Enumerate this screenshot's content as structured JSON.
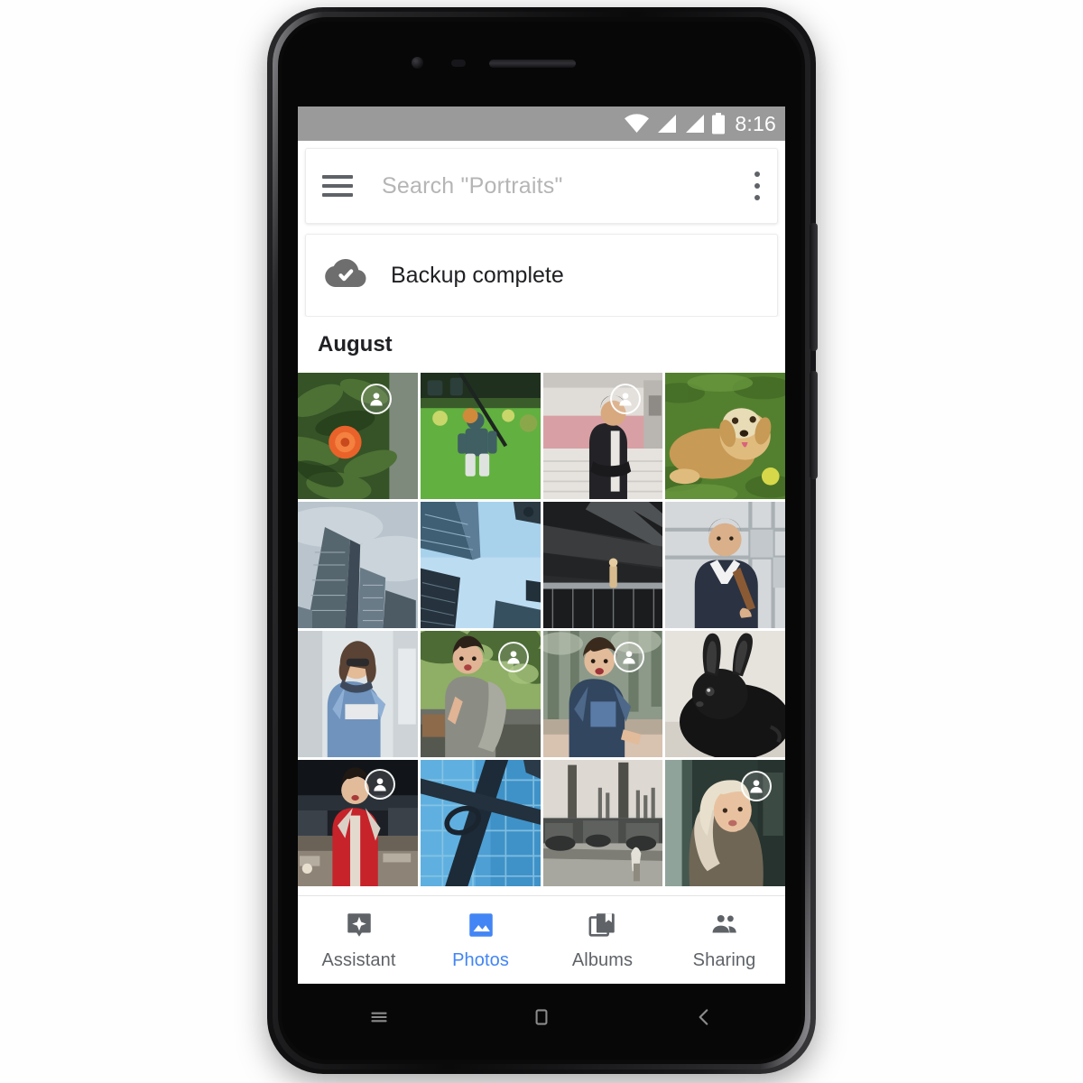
{
  "device": {
    "name": "android-smartphone",
    "hardware_buttons": [
      "volume-rocker",
      "power-button"
    ]
  },
  "statusbar": {
    "time": "8:16",
    "icons": [
      "wifi-icon",
      "signal-icon",
      "signal-icon",
      "battery-icon"
    ],
    "background": "#9a9a9a"
  },
  "searchbar": {
    "menu_icon": "hamburger-menu-icon",
    "placeholder": "Search \"Portraits\"",
    "value": "",
    "overflow_icon": "kebab-menu-icon"
  },
  "backup_card": {
    "icon": "cloud-done-icon",
    "label": "Backup complete"
  },
  "section": {
    "month": "August"
  },
  "bottom_nav": {
    "active": "Photos",
    "accent": "#4285f4",
    "inactive_color": "#5f6368",
    "items": [
      {
        "label": "Assistant",
        "icon": "assistant-sparkle-icon",
        "active": false
      },
      {
        "label": "Photos",
        "icon": "photos-image-icon",
        "active": true
      },
      {
        "label": "Albums",
        "icon": "albums-book-icon",
        "active": false
      },
      {
        "label": "Sharing",
        "icon": "sharing-people-icon",
        "active": false
      }
    ]
  },
  "android_nav": {
    "items": [
      "recents-key",
      "home-key",
      "back-key"
    ]
  },
  "photo_grid": {
    "columns": 4,
    "rows": 4,
    "photos": [
      {
        "id": "p1",
        "caption": "Orange flower among green leaves",
        "face_badge": true,
        "palette": [
          "#2e4a23",
          "#4d7034",
          "#e8622a"
        ]
      },
      {
        "id": "p2",
        "caption": "Toy robot on green lawn",
        "face_badge": false,
        "palette": [
          "#3f8f2f",
          "#62b040",
          "#2c3f3a"
        ]
      },
      {
        "id": "p3",
        "caption": "Man standing in shopping mall",
        "face_badge": true,
        "palette": [
          "#e7e3df",
          "#d8a0a4",
          "#232327"
        ]
      },
      {
        "id": "p4",
        "caption": "Golden retriever lying in grass",
        "face_badge": false,
        "palette": [
          "#53802f",
          "#c79a55",
          "#e8dcb6"
        ]
      },
      {
        "id": "p5",
        "caption": "Skyscrapers on overcast sky",
        "face_badge": false,
        "palette": [
          "#b9c4cc",
          "#6a7b88",
          "#3d4a55"
        ]
      },
      {
        "id": "p6",
        "caption": "Looking up at glass towers",
        "face_badge": false,
        "palette": [
          "#bcdcf2",
          "#5d7d96",
          "#26323d"
        ]
      },
      {
        "id": "p7",
        "caption": "Dark architectural interior",
        "face_badge": false,
        "palette": [
          "#2a2b2c",
          "#4f5254",
          "#9aa0a3"
        ]
      },
      {
        "id": "p8",
        "caption": "Man with backpack outdoors",
        "face_badge": false,
        "palette": [
          "#d4d8da",
          "#2b3242",
          "#d9b08a"
        ]
      },
      {
        "id": "p9",
        "caption": "Woman in denim jacket by wall",
        "face_badge": false,
        "palette": [
          "#dfe4e7",
          "#6f93bd",
          "#3e4a5c"
        ]
      },
      {
        "id": "p10",
        "caption": "Woman with grey backpack in park",
        "face_badge": true,
        "palette": [
          "#4c6b35",
          "#8fae66",
          "#6b6f68"
        ]
      },
      {
        "id": "p11",
        "caption": "Woman in denim jacket on street",
        "face_badge": true,
        "palette": [
          "#8d9a8a",
          "#32465f",
          "#d8c2b0"
        ]
      },
      {
        "id": "p12",
        "caption": "Black rabbit portrait",
        "face_badge": false,
        "palette": [
          "#e6e2dc",
          "#1a1a1a",
          "#3a3a3a"
        ]
      },
      {
        "id": "p13",
        "caption": "Person in red jacket at night",
        "face_badge": true,
        "palette": [
          "#1c2026",
          "#c6232b",
          "#d9cfc5"
        ]
      },
      {
        "id": "p14",
        "caption": "Blue glass facade with beams",
        "face_badge": false,
        "palette": [
          "#4e9fd4",
          "#1d2b38",
          "#8fc8e6"
        ]
      },
      {
        "id": "p15",
        "caption": "Industrial smokestacks, monochrome",
        "face_badge": false,
        "palette": [
          "#d7d4cd",
          "#6b6b66",
          "#2f3231"
        ]
      },
      {
        "id": "p16",
        "caption": "Blonde woman indoors",
        "face_badge": true,
        "palette": [
          "#2c3a35",
          "#ddd2c0",
          "#6f6656"
        ]
      }
    ]
  }
}
